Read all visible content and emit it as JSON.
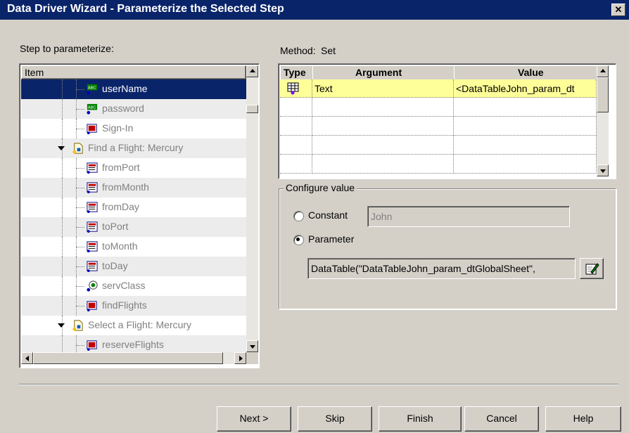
{
  "window": {
    "title": "Data Driver Wizard - Parameterize the Selected Step",
    "close": "✕"
  },
  "left": {
    "label": "Step to parameterize:",
    "column_header": "Item",
    "items": [
      {
        "label": "userName",
        "icon": "webedit-icon",
        "selected": true
      },
      {
        "label": "password",
        "icon": "webedit-icon"
      },
      {
        "label": "Sign-In",
        "icon": "image-button-icon"
      },
      {
        "label": "Find a Flight: Mercury",
        "icon": "page-icon"
      },
      {
        "label": "fromPort",
        "icon": "weblist-icon"
      },
      {
        "label": "fromMonth",
        "icon": "weblist-icon"
      },
      {
        "label": "fromDay",
        "icon": "weblist-icon"
      },
      {
        "label": "toPort",
        "icon": "weblist-icon"
      },
      {
        "label": "toMonth",
        "icon": "weblist-icon"
      },
      {
        "label": "toDay",
        "icon": "weblist-icon"
      },
      {
        "label": "servClass",
        "icon": "radio-group-icon"
      },
      {
        "label": "findFlights",
        "icon": "image-button-icon"
      },
      {
        "label": "Select a Flight: Mercury",
        "icon": "page-icon"
      },
      {
        "label": "reserveFlights",
        "icon": "image-button-icon"
      }
    ]
  },
  "method": {
    "label": "Method:",
    "value": "Set"
  },
  "grid": {
    "headers": {
      "type": "Type",
      "argument": "Argument",
      "value": "Value"
    },
    "row": {
      "type": "Text",
      "value": "<DataTableJohn_param_dt"
    }
  },
  "configure": {
    "title": "Configure value",
    "constant_label": "Constant",
    "constant_value": "John",
    "parameter_label": "Parameter",
    "parameter_value": "DataTable(\"DataTableJohn_param_dtGlobalSheet\","
  },
  "buttons": {
    "next": "Next >",
    "skip": "Skip",
    "finish": "Finish",
    "cancel": "Cancel",
    "help": "Help"
  },
  "colors": {
    "title_bg": "#0a246a",
    "selection": "#0a246a",
    "row_highlight": "#ffff99",
    "dialog_bg": "#d4d0c8"
  }
}
